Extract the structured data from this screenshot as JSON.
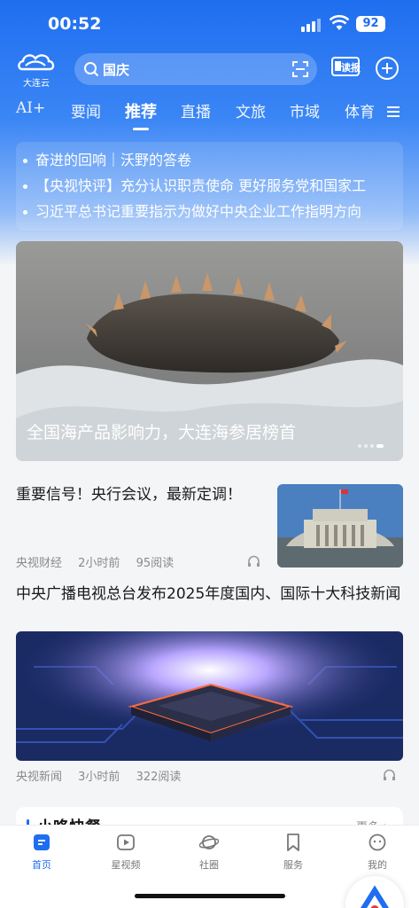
{
  "status_bar": {
    "time": "00:52",
    "battery": "92"
  },
  "header": {
    "logo_text": "大连云",
    "search_value": "国庆",
    "read_label": "读报"
  },
  "tabs": [
    "AI+",
    "要闻",
    "推荐",
    "直播",
    "文旅",
    "市域",
    "体育"
  ],
  "active_tab": "推荐",
  "headlines": [
    "奋进的回响｜沃野的答卷",
    "【央视快评】充分认识职责使命 更好服务党和国家工",
    "习近平总书记重要指示为做好中央企业工作指明方向"
  ],
  "banner": {
    "caption": "全国海产品影响力，大连海参居榜首"
  },
  "news": [
    {
      "title": "重要信号！央行会议，最新定调！",
      "source": "央视财经",
      "time": "2小时前",
      "reads": "95阅读"
    },
    {
      "title": "中央广播电视总台发布2025年度国内、国际十大科技新闻",
      "source": "央视新闻",
      "time": "3小时前",
      "reads": "322阅读"
    }
  ],
  "section": {
    "title": "小咚快餐",
    "more": "更多 >"
  },
  "bottom_nav": [
    {
      "label": "首页",
      "icon": "home-icon"
    },
    {
      "label": "星视频",
      "icon": "video-icon"
    },
    {
      "label": "社圈",
      "icon": "planet-icon"
    },
    {
      "label": "服务",
      "icon": "bookmark-icon"
    },
    {
      "label": "我的",
      "icon": "profile-icon"
    }
  ],
  "colors": {
    "accent": "#1f6ef0",
    "header_gradient_top": "#1f6ef0"
  }
}
